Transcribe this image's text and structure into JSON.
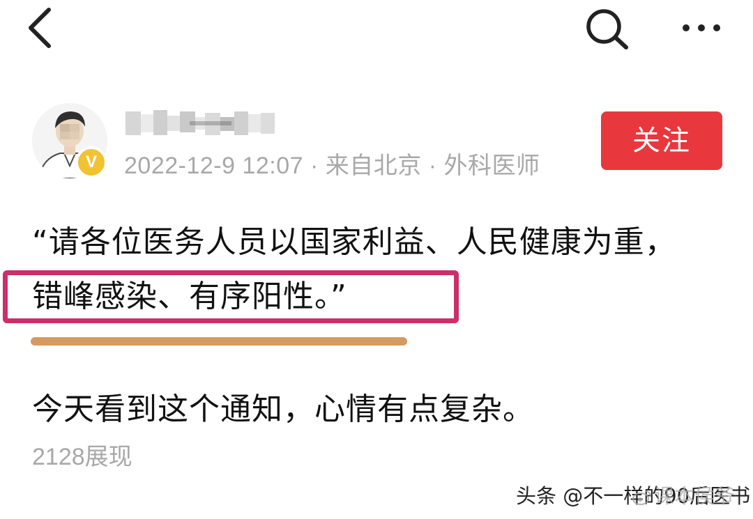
{
  "header": {
    "back_icon": "chevron-left-icon",
    "search_icon": "search-icon",
    "more_icon": "more-horizontal-icon"
  },
  "author": {
    "avatar": "avatar-illustration",
    "verified_badge": "V",
    "name_blurred": true,
    "meta": "2022-12-9 12:07 · 来自北京 · 外科医师",
    "badge_color": "#f1c232"
  },
  "follow": {
    "label": "关注",
    "color": "#e8383d"
  },
  "post": {
    "quote_line_1": "“请各位医务人员以国家利益、人民健康为重，",
    "quote_line_2": "错峰感染、有序阳性。”",
    "body": "今天看到这个通知，心情有点复杂。",
    "views": "2128展现",
    "highlight_color": "#cc2f6a",
    "underline_color": "#d49a5e"
  },
  "watermark": {
    "toutiao": "头条 @不一样的90后医书",
    "weibo": "课本侯爷"
  }
}
